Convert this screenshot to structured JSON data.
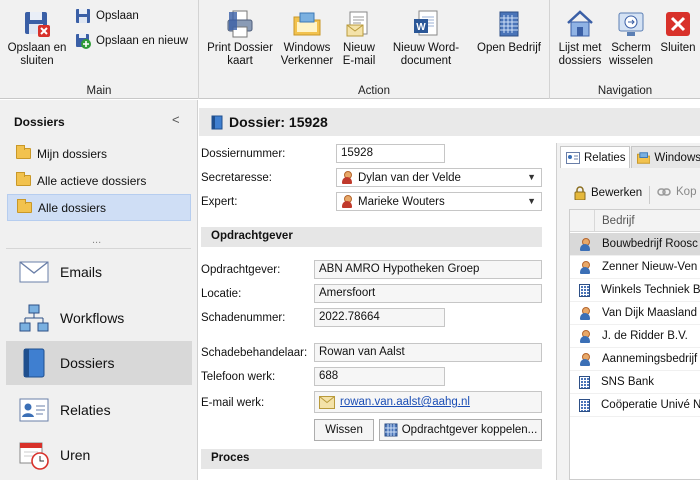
{
  "ribbon": {
    "main": {
      "save_close": "Opslaan en sluiten",
      "save": "Opslaan",
      "save_new": "Opslaan en nieuw",
      "group": "Main"
    },
    "action": {
      "print": "Print Dossier kaart",
      "explorer": "Windows Verkenner",
      "email": "Nieuw E-mail",
      "word": "Nieuw Word-document",
      "open_company": "Open Bedrijf",
      "group": "Action"
    },
    "navigation": {
      "list": "Lijst met dossiers",
      "switch": "Scherm wisselen",
      "close": "Sluiten",
      "group": "Navigation"
    }
  },
  "sidebar": {
    "title": "Dossiers",
    "collapse": "<",
    "folders": [
      "Mijn dossiers",
      "Alle actieve dossiers",
      "Alle dossiers"
    ],
    "more": "...",
    "nav": [
      "Emails",
      "Workflows",
      "Dossiers",
      "Relaties",
      "Uren"
    ]
  },
  "main": {
    "title": "Dossier: 15928",
    "fields": {
      "dossiernummer_label": "Dossiernummer:",
      "dossiernummer": "15928",
      "secretaresse_label": "Secretaresse:",
      "secretaresse": "Dylan van der Velde",
      "expert_label": "Expert:",
      "expert": "Marieke Wouters"
    },
    "section_opdrachtgever": "Opdrachtgever",
    "opdrachtgever": {
      "opdrachtgever_label": "Opdrachtgever:",
      "opdrachtgever": "ABN AMRO Hypotheken Groep",
      "locatie_label": "Locatie:",
      "locatie": "Amersfoort",
      "schadenummer_label": "Schadenummer:",
      "schadenummer": "2022.78664",
      "behandelaar_label": "Schadebehandelaar:",
      "behandelaar": "Rowan van Aalst",
      "telefoon_label": "Telefoon werk:",
      "telefoon": "688",
      "email_label": "E-mail werk:",
      "email": "rowan.van.aalst@aahg.nl"
    },
    "buttons": {
      "clear": "Wissen",
      "link": "Opdrachtgever koppelen..."
    },
    "section_proces": "Proces"
  },
  "right_panel": {
    "tabs": [
      "Relaties",
      "Windows"
    ],
    "edit": "Bewerken",
    "link": "Kop",
    "column": "Bedrijf",
    "rows": [
      {
        "name": "Bouwbedrijf Roosc",
        "icon": "person-icon"
      },
      {
        "name": "Zenner Nieuw-Ven",
        "icon": "person-icon"
      },
      {
        "name": "Winkels Techniek B",
        "icon": "building-icon"
      },
      {
        "name": "Van Dijk Maasland",
        "icon": "person-icon"
      },
      {
        "name": "J. de Ridder B.V.",
        "icon": "person-icon"
      },
      {
        "name": "Aannemingsbedrijf",
        "icon": "person-icon"
      },
      {
        "name": "SNS Bank",
        "icon": "building-icon"
      },
      {
        "name": "Coöperatie Univé N",
        "icon": "building-icon"
      }
    ]
  }
}
